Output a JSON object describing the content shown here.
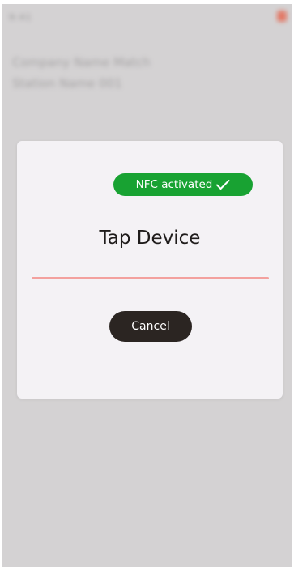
{
  "background": {
    "time": "9:41",
    "line1": "Company Name Match",
    "line2": "Station Name 001"
  },
  "dialog": {
    "nfc_badge_label": "NFC activated",
    "nfc_badge_icon": "check-icon",
    "title": "Tap Device",
    "cancel_label": "Cancel"
  },
  "colors": {
    "badge": "#18a232",
    "progress": "#f3a19e",
    "cancel_button": "#2b2522",
    "status_dot": "#e8553a"
  }
}
